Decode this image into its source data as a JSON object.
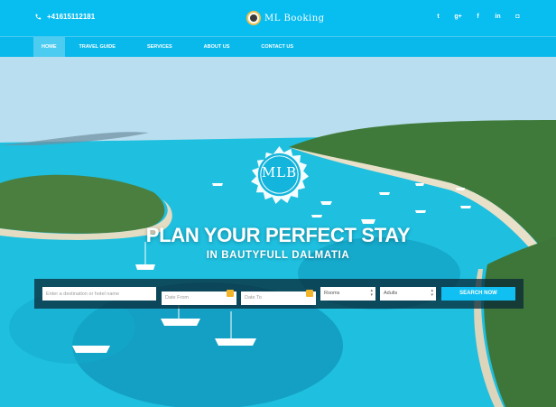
{
  "topbar": {
    "phone": "+41615112181",
    "brand_name": "ML Booking",
    "socials": [
      {
        "icon": "twitter-icon",
        "glyph": "t"
      },
      {
        "icon": "google-plus-icon",
        "glyph": "g+"
      },
      {
        "icon": "facebook-icon",
        "glyph": "f"
      },
      {
        "icon": "linkedin-icon",
        "glyph": "in"
      },
      {
        "icon": "instagram-icon",
        "glyph": "◘"
      }
    ]
  },
  "nav": {
    "items": [
      {
        "label": "HOME",
        "active": true
      },
      {
        "label": "TRAVEL GUIDE",
        "active": false
      },
      {
        "label": "SERVICES",
        "active": false
      },
      {
        "label": "ABOUT US",
        "active": false
      },
      {
        "label": "CONTACT US",
        "active": false
      }
    ]
  },
  "hero": {
    "emblem_text": "MLB",
    "headline": "PLAN YOUR PERFECT STAY",
    "subheadline": "IN BAUTYFULL DALMATIA"
  },
  "search": {
    "destination_placeholder": "Enter a destination or hotel name",
    "date_from_placeholder": "Date From",
    "date_to_placeholder": "Date To",
    "rooms_value": "Rooms",
    "adults_value": "Adults",
    "button_label": "SEARCH NOW"
  },
  "colors": {
    "topbar": "#08bdf0",
    "nav": "#09b9ec",
    "search_button": "#10c0f2",
    "calendar_icon": "#f2b428"
  }
}
